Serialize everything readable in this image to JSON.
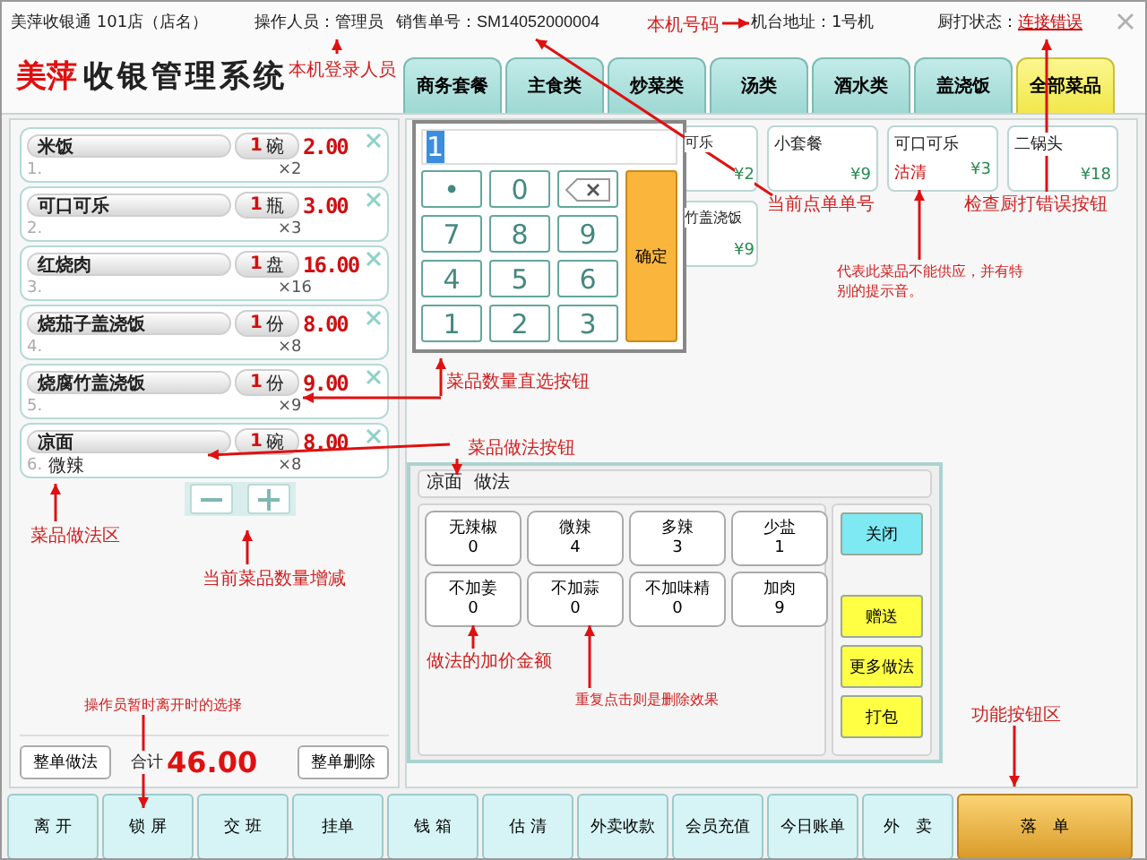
{
  "header": {
    "shop": "美萍收银通 101店（店名）",
    "operator_label": "操作人员：",
    "operator": "管理员",
    "order_no_label": "销售单号：",
    "order_no": "SM14052000004",
    "terminal_label": "机台地址：",
    "terminal": "1号机",
    "printer_label": "厨打状态：",
    "printer_status": "连接错误"
  },
  "logo": {
    "brand": "美萍",
    "title": "收银管理系统"
  },
  "categories": [
    {
      "label": "商务套餐",
      "selected": false
    },
    {
      "label": "主食类",
      "selected": false
    },
    {
      "label": "炒菜类",
      "selected": false
    },
    {
      "label": "汤类",
      "selected": false
    },
    {
      "label": "酒水类",
      "selected": false
    },
    {
      "label": "盖浇饭",
      "selected": false
    },
    {
      "label": "全部菜品",
      "selected": true
    }
  ],
  "order_items": [
    {
      "index": "1.",
      "name": "米饭",
      "qty": "1",
      "unit": "碗",
      "price": "2.00",
      "times": "×2"
    },
    {
      "index": "2.",
      "name": "可口可乐",
      "qty": "1",
      "unit": "瓶",
      "price": "3.00",
      "times": "×3"
    },
    {
      "index": "3.",
      "name": "红烧肉",
      "qty": "1",
      "unit": "盘",
      "price": "16.00",
      "times": "×16"
    },
    {
      "index": "4.",
      "name": "烧茄子盖浇饭",
      "qty": "1",
      "unit": "份",
      "price": "8.00",
      "times": "×8"
    },
    {
      "index": "5.",
      "name": "烧腐竹盖浇饭",
      "qty": "1",
      "unit": "份",
      "price": "9.00",
      "times": "×9"
    },
    {
      "index": "6.",
      "name": "凉面",
      "qty": "1",
      "unit": "碗",
      "price": "8.00",
      "times": "×8",
      "practice": "微辣"
    }
  ],
  "order_footer": {
    "practice_button": "整单做法",
    "total_label": "合计",
    "total": "46.00",
    "delete_button": "整单删除"
  },
  "keypad": {
    "value": "1",
    "confirm": "确定",
    "keys": [
      {
        "kind": "key",
        "label": "•"
      },
      {
        "kind": "key",
        "label": "0"
      },
      {
        "kind": "backspace"
      },
      {
        "kind": "key",
        "label": "7"
      },
      {
        "kind": "key",
        "label": "8"
      },
      {
        "kind": "key",
        "label": "9"
      },
      {
        "kind": "key",
        "label": "4"
      },
      {
        "kind": "key",
        "label": "5"
      },
      {
        "kind": "key",
        "label": "6"
      },
      {
        "kind": "key",
        "label": "1"
      },
      {
        "kind": "key",
        "label": "2"
      },
      {
        "kind": "key",
        "label": "3"
      }
    ]
  },
  "menu_rows": [
    [
      {
        "name": "可乐",
        "price": "¥2"
      },
      {
        "name": "小套餐",
        "price": "¥9"
      },
      {
        "name": "可口可乐",
        "price": "¥3",
        "status": "沽清"
      },
      {
        "name": "二锅头",
        "price": "¥18"
      }
    ],
    [
      {
        "name": "竹盖浇饭",
        "price": "¥9"
      }
    ]
  ],
  "practice": {
    "dish": "凉面",
    "title": "做法",
    "options": [
      {
        "name": "无辣椒",
        "price": "0"
      },
      {
        "name": "微辣",
        "price": "4"
      },
      {
        "name": "多辣",
        "price": "3"
      },
      {
        "name": "少盐",
        "price": "1"
      },
      {
        "name": "不加姜",
        "price": "0"
      },
      {
        "name": "不加蒜",
        "price": "0"
      },
      {
        "name": "不加味精",
        "price": "0"
      },
      {
        "name": "加肉",
        "price": "9"
      }
    ],
    "side_buttons": [
      {
        "label": "关闭",
        "kind": "close"
      },
      {
        "label": "赠送",
        "kind": "action"
      },
      {
        "label": "更多做法",
        "kind": "action"
      },
      {
        "label": "打包",
        "kind": "action"
      }
    ]
  },
  "function_bar": [
    {
      "label": "离 开",
      "kind": "normal"
    },
    {
      "label": "锁 屏",
      "kind": "normal"
    },
    {
      "label": "交 班",
      "kind": "normal"
    },
    {
      "label": "挂单",
      "kind": "normal"
    },
    {
      "label": "钱 箱",
      "kind": "normal"
    },
    {
      "label": "估 清",
      "kind": "normal"
    },
    {
      "label": "外卖收款",
      "kind": "normal"
    },
    {
      "label": "会员充值",
      "kind": "normal"
    },
    {
      "label": "今日账单",
      "kind": "normal"
    },
    {
      "label": "外　卖",
      "kind": "normal"
    },
    {
      "label": "落　单",
      "kind": "primary"
    }
  ],
  "annotations": [
    {
      "text": "本机登录人员"
    },
    {
      "text": "本机号码"
    },
    {
      "text": "当前点单单号"
    },
    {
      "text": "检查厨打错误按钮"
    },
    {
      "text": "代表此菜品不能供应，并有特别的提示音。"
    },
    {
      "text": "菜品数量直选按钮"
    },
    {
      "text": "菜品做法按钮"
    },
    {
      "text": "菜品做法区"
    },
    {
      "text": "当前菜品数量增减"
    },
    {
      "text": "操作员暂时离开时的选择"
    },
    {
      "text": "做法的加价金额"
    },
    {
      "text": "重复点击则是删除效果"
    },
    {
      "text": "功能按钮区"
    }
  ]
}
